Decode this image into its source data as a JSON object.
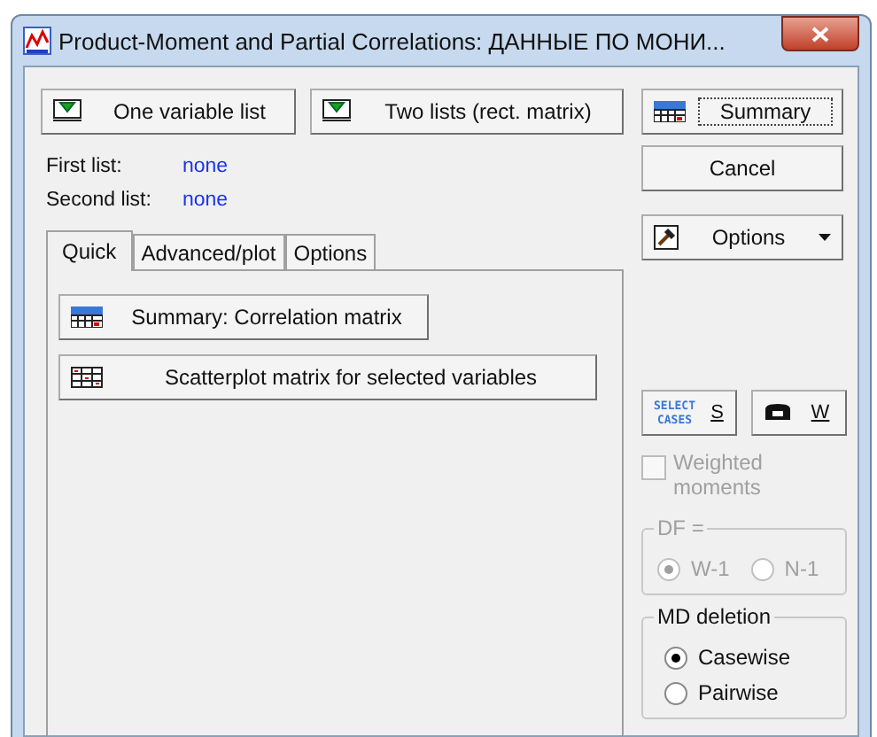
{
  "window": {
    "title": "Product-Moment and Partial Correlations: ДАННЫЕ ПО МОНИ..."
  },
  "top_buttons": [
    {
      "label": "One variable list"
    },
    {
      "label": "Two lists (rect. matrix)"
    }
  ],
  "lists": [
    {
      "label": "First list:",
      "value": "none"
    },
    {
      "label": "Second list:",
      "value": "none"
    }
  ],
  "tabs": [
    {
      "label": "Quick",
      "selected": true
    },
    {
      "label": "Advanced/plot",
      "selected": false
    },
    {
      "label": "Options",
      "selected": false
    }
  ],
  "quick_buttons": [
    {
      "kind": "summary",
      "label": "Summary:  Correlation matrix"
    },
    {
      "kind": "scatter",
      "label": "Scatterplot matrix for selected variables"
    }
  ],
  "side": {
    "summary": "Summary",
    "cancel": "Cancel",
    "options": "Options",
    "select_cases_icon": [
      "SELECT",
      "CASES"
    ],
    "select_cases": "S",
    "weight": "W"
  },
  "weighted": {
    "label": "Weighted moments",
    "checked": false,
    "disabled": true
  },
  "df": {
    "title": "DF =",
    "disabled": true,
    "options": [
      {
        "label": "W-1",
        "selected": true
      },
      {
        "label": "N-1",
        "selected": false
      }
    ]
  },
  "md_deletion": {
    "title": "MD deletion",
    "options": [
      {
        "label": "Casewise",
        "selected": true
      },
      {
        "label": "Pairwise",
        "selected": false
      }
    ]
  }
}
